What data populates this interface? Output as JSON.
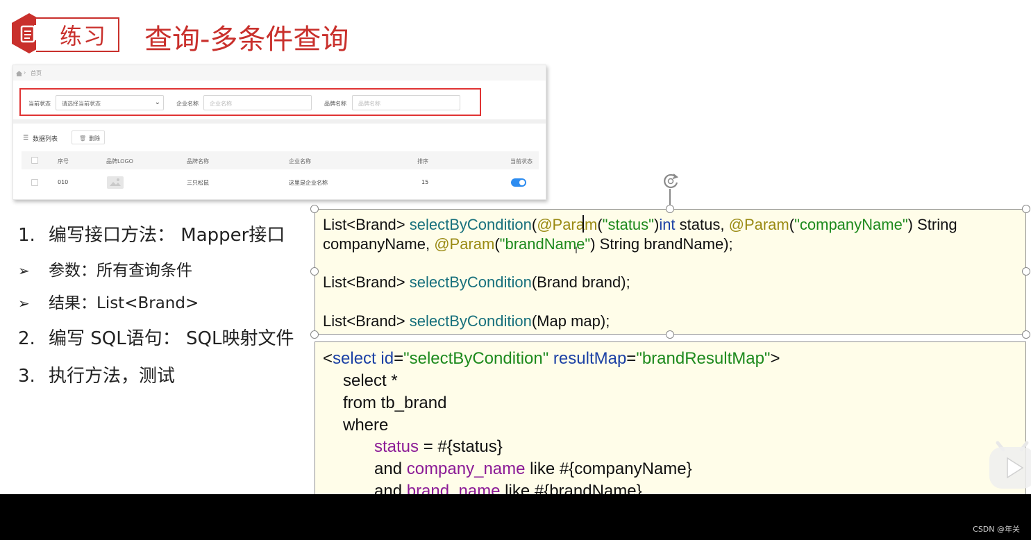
{
  "header": {
    "tag": "练习",
    "title": "查询-多条件查询",
    "accent_color": "#c9302c"
  },
  "screenshot": {
    "breadcrumb": "首页",
    "filters": {
      "status_label": "当前状态",
      "status_value": "请选择当前状态",
      "company_label": "企业名称",
      "company_placeholder": "企业名称",
      "brand_label": "品牌名称",
      "brand_placeholder": "品牌名称"
    },
    "list_title": "数据列表",
    "delete_label": "删除",
    "columns": [
      "序号",
      "品牌LOGO",
      "品牌名称",
      "企业名称",
      "排序",
      "当前状态"
    ],
    "rows": [
      {
        "id": "010",
        "brand_name": "三只松鼠",
        "company_name": "这里是企业名称",
        "ordered": "15",
        "status_on": true
      }
    ]
  },
  "steps": {
    "s1_num": "1.",
    "s1": "编写接口方法： Mapper接口",
    "sub1_arrow": "➢",
    "sub1": "参数：所有查询条件",
    "sub2_arrow": "➢",
    "sub2": "结果：List<Brand>",
    "s2_num": "2.",
    "s2": "编写 SQL语句： SQL映射文件",
    "s3_num": "3.",
    "s3": "执行方法，测试"
  },
  "interface_code": {
    "l1_a": "List<Brand> ",
    "l1_m": "selectByCondition",
    "l1_p1": "(",
    "l1_an1": "@Param",
    "l1_s1a": "(",
    "l1_s1": "\"status\"",
    "l1_s1b": ")",
    "l1_kw": "int",
    "l1_r1": " status, ",
    "l1_an2": "@Param",
    "l1_s2a": "(",
    "l1_s2": "\"companyName\"",
    "l1_s2b": ")",
    "l1_r2": " String",
    "l2_a": "companyName, ",
    "l2_an": "@Param",
    "l2_s1a": "(",
    "l2_s": "\"brandName\"",
    "l2_s1b": ")",
    "l2_r": " String brandName);",
    "l3_a": "List<Brand> ",
    "l3_m": "selectByCondition",
    "l3_r": "(Brand brand);",
    "l4_a": "List<Brand> ",
    "l4_m": "selectByCondition",
    "l4_r": "(Map map);"
  },
  "xml_code": {
    "l1_open": "<",
    "l1_tag": "select",
    "l1_id_attr": " id",
    "l1_eq1": "=",
    "l1_id_val": "\"selectByCondition\"",
    "l1_rm_attr": " resultMap",
    "l1_eq2": "=",
    "l1_rm_val": "\"brandResultMap\"",
    "l1_close": ">",
    "l2": "select *",
    "l3": "from tb_brand",
    "l4": "where",
    "l5_f": "status",
    "l5_r": " = #{status}",
    "l6_a": "and ",
    "l6_f": "company_name",
    "l6_r": " like #{companyName}",
    "l7_a": "and ",
    "l7_f": "brand_name",
    "l7_r": " like #{brandName}"
  },
  "watermark": "CSDN @年关"
}
